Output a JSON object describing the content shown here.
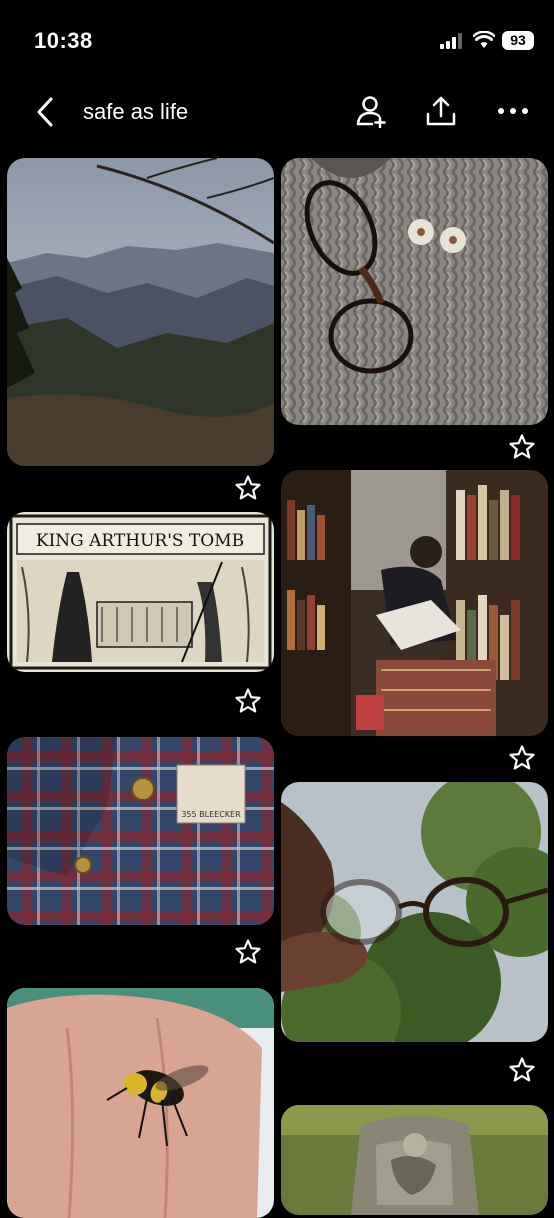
{
  "status_bar": {
    "time": "10:38",
    "battery": "93"
  },
  "header": {
    "title": "safe as life"
  },
  "pins": [
    {
      "icon": "mountain-landscape"
    },
    {
      "icon": "sweater-glasses"
    },
    {
      "icon": "tomb-illustration",
      "text": "KING ARTHUR'S TOMB"
    },
    {
      "icon": "bookstore-reader"
    },
    {
      "icon": "plaid-shirt",
      "label_text": "355 BLEECKER"
    },
    {
      "icon": "glasses-trees"
    },
    {
      "icon": "bee-hand"
    },
    {
      "icon": "mossy-grave"
    }
  ],
  "colors": {
    "background": "#000000",
    "text": "#ffffff"
  }
}
